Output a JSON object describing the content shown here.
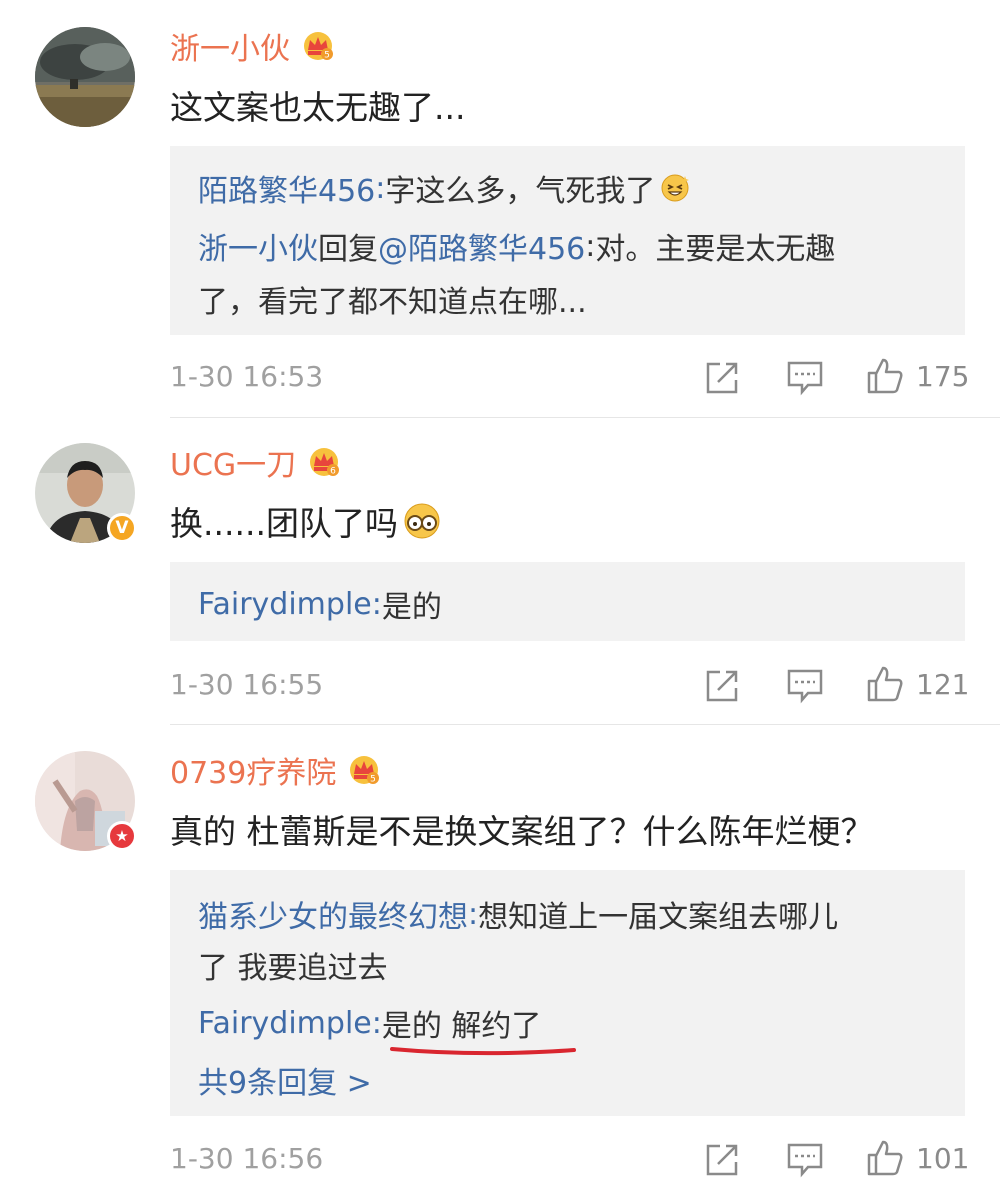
{
  "comments": [
    {
      "username": "浙一小伙",
      "content": "这文案也太无趣了...",
      "replies": [
        {
          "name": "陌路繁华456",
          "sep": ": ",
          "text": "字这么多，气死我了"
        },
        {
          "name": "浙一小伙",
          "action": "回复",
          "mention": "@陌路繁华456",
          "sep": ":",
          "text1": "对。主要是太无趣",
          "text2": "了，看完了都不知道点在哪..."
        }
      ],
      "time": "1-30 16:53",
      "likes": "175"
    },
    {
      "username": "UCG一刀",
      "content": "换......团队了吗",
      "replies": [
        {
          "name": "Fairydimple",
          "sep": ": ",
          "text": "是的"
        }
      ],
      "time": "1-30 16:55",
      "likes": "121"
    },
    {
      "username": "0739疗养院",
      "content": "真的 杜蕾斯是不是换文案组了？什么陈年烂梗？",
      "replies": [
        {
          "name": "猫系少女的最终幻想",
          "sep": ": ",
          "text1": "想知道上一届文案组去哪儿",
          "text2": "了 我要追过去"
        },
        {
          "name": "Fairydimple",
          "sep": ": ",
          "text": "是的 解约了"
        }
      ],
      "more_replies": "共9条回复 >",
      "time": "1-30 16:56",
      "likes": "101"
    }
  ],
  "icons": {
    "share": "share-icon",
    "comment": "comment-icon",
    "like": "like-icon",
    "vip_crown": "vip-crown-icon",
    "verified": "verified-badge-icon"
  },
  "colors": {
    "username": "#eb7350",
    "reply_name": "#3f6ba7",
    "reply_bg": "#f2f2f2",
    "underline": "#d9262f"
  }
}
